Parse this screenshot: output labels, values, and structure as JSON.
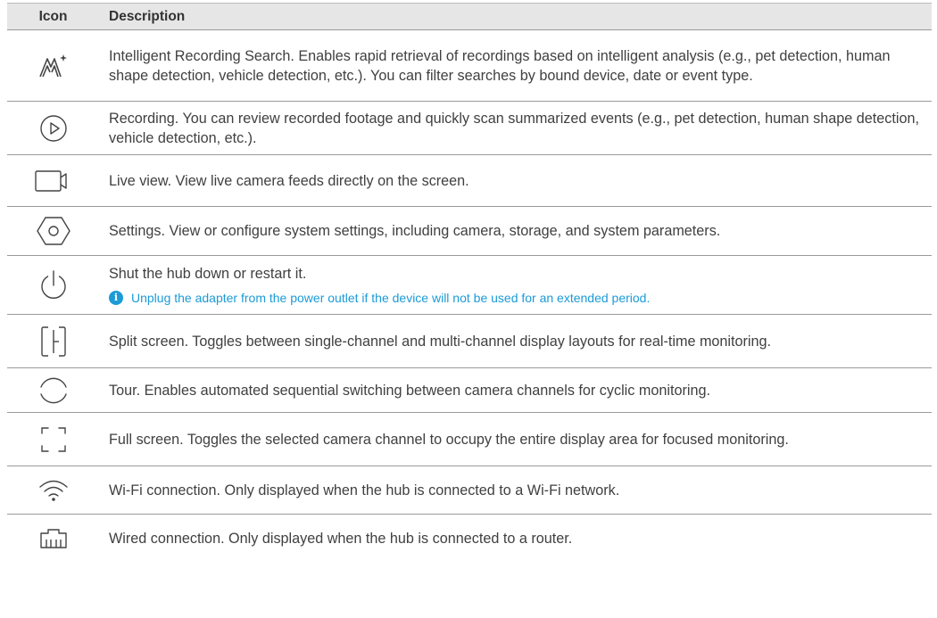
{
  "table": {
    "header": {
      "icon": "Icon",
      "description": "Description"
    },
    "rows": [
      {
        "icon": "intelligent-search-icon",
        "description": "Intelligent Recording Search. Enables rapid retrieval of recordings based on intelligent analysis (e.g., pet detection, human shape detection, vehicle detection, etc.). You can filter searches by bound device, date or event type."
      },
      {
        "icon": "play-icon",
        "description": "Recording. You can review recorded footage and quickly scan summarized events (e.g., pet detection, human shape detection, vehicle detection, etc.)."
      },
      {
        "icon": "camera-icon",
        "description": "Live view. View live camera feeds directly on the screen."
      },
      {
        "icon": "settings-icon",
        "description": "Settings. View or configure system settings, including camera, storage, and system parameters."
      },
      {
        "icon": "power-icon",
        "description": "Shut the hub down or restart it.",
        "note": "Unplug the adapter from the power outlet if the device will not be used for an extended period.",
        "note_icon": "info-icon"
      },
      {
        "icon": "split-screen-icon",
        "description": "Split screen. Toggles between single-channel and multi-channel display layouts for real-time monitoring."
      },
      {
        "icon": "tour-icon",
        "description": "Tour. Enables automated sequential switching between camera channels for cyclic monitoring."
      },
      {
        "icon": "full-screen-icon",
        "description": "Full screen. Toggles the selected camera channel to occupy the entire display area for focused monitoring."
      },
      {
        "icon": "wifi-icon",
        "description": "Wi-Fi connection. Only displayed when the hub is connected to a Wi-Fi network."
      },
      {
        "icon": "wired-connection-icon",
        "description": "Wired connection. Only displayed when the hub is connected to a router."
      }
    ]
  },
  "colors": {
    "note": "#1b9bd7",
    "header_bg": "#e6e6e6",
    "text": "#404040"
  }
}
